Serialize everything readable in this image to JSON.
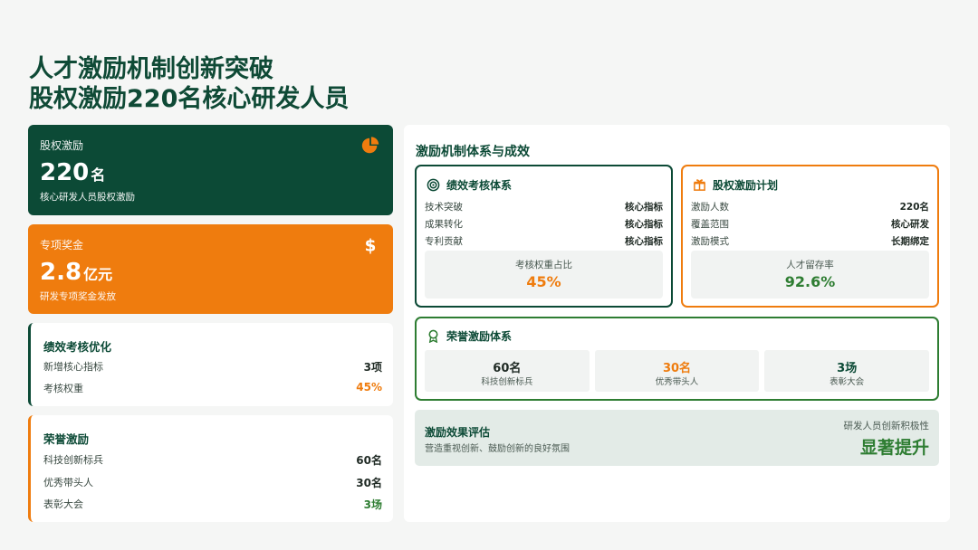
{
  "title": {
    "line1": "人才激励机制创新突破",
    "line2": "股权激励220名核心研发人员"
  },
  "kpis": [
    {
      "label": "股权激励",
      "value": "220",
      "unit": "名",
      "sub": "核心研发人员股权激励",
      "icon": "pie-chart-icon"
    },
    {
      "label": "专项奖金",
      "value": "2.8",
      "unit": "亿元",
      "sub": "研发专项奖金发放",
      "icon": "dollar-icon"
    }
  ],
  "performance": {
    "title": "绩效考核优化",
    "rows": [
      {
        "label": "新增核心指标",
        "value": "3项"
      },
      {
        "label": "考核权重",
        "value": "45%"
      }
    ]
  },
  "honor": {
    "title": "荣誉激励",
    "rows": [
      {
        "label": "科技创新标兵",
        "value": "60名"
      },
      {
        "label": "优秀带头人",
        "value": "30名"
      },
      {
        "label": "表彰大会",
        "value": "3场"
      }
    ]
  },
  "panel": {
    "title": "激励机制体系与成效",
    "perf_system": {
      "title": "绩效考核体系",
      "icon": "target-icon",
      "rows": [
        {
          "label": "技术突破",
          "value": "核心指标"
        },
        {
          "label": "成果转化",
          "value": "核心指标"
        },
        {
          "label": "专利贡献",
          "value": "核心指标"
        }
      ],
      "metric_label": "考核权重占比",
      "metric_value": "45%"
    },
    "equity_plan": {
      "title": "股权激励计划",
      "icon": "gift-icon",
      "rows": [
        {
          "label": "激励人数",
          "value": "220名"
        },
        {
          "label": "覆盖范围",
          "value": "核心研发"
        },
        {
          "label": "激励模式",
          "value": "长期绑定"
        }
      ],
      "metric_label": "人才留存率",
      "metric_value": "92.6%"
    },
    "honor_system": {
      "title": "荣誉激励体系",
      "icon": "medal-icon",
      "cells": [
        {
          "value": "60名",
          "label": "科技创新标兵"
        },
        {
          "value": "30名",
          "label": "优秀带头人"
        },
        {
          "value": "3场",
          "label": "表彰大会"
        }
      ]
    },
    "evaluation": {
      "title": "激励效果评估",
      "sub": "营造重视创新、鼓励创新的良好氛围",
      "metric_label": "研发人员创新积极性",
      "metric_value": "显著提升"
    }
  },
  "colors": {
    "dark_green": "#0c4a36",
    "orange": "#ef7c0e",
    "green": "#2e7d32"
  }
}
